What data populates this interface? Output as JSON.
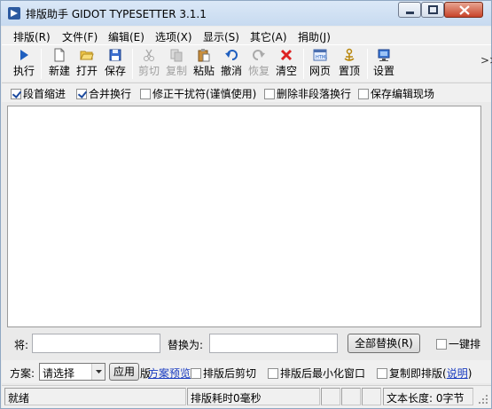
{
  "window": {
    "title": "排版助手 GIDOT TYPESETTER 3.1.1"
  },
  "menu": [
    "排版(R)",
    "文件(F)",
    "编辑(E)",
    "选项(X)",
    "显示(S)",
    "其它(A)",
    "捐助(J)"
  ],
  "toolbar": {
    "run": "执行",
    "new": "新建",
    "open": "打开",
    "save": "保存",
    "cut": "剪切",
    "copy": "复制",
    "paste": "粘贴",
    "undo": "撤消",
    "redo": "恢复",
    "clear": "清空",
    "web": "网页",
    "top": "置顶",
    "settings": "设置",
    "more": ">>"
  },
  "options": [
    {
      "label": "段首缩进",
      "checked": true
    },
    {
      "label": "合并换行",
      "checked": true
    },
    {
      "label": "修正干扰符(谨慎使用)",
      "checked": false
    },
    {
      "label": "删除非段落换行",
      "checked": false
    },
    {
      "label": "保存编辑现场",
      "checked": false
    }
  ],
  "replace": {
    "find_label": "将:",
    "find_value": "",
    "with_label": "替换为:",
    "with_value": "",
    "replace_all_button": "全部替换(R)",
    "one_click_label": "一键排"
  },
  "scheme": {
    "label": "方案:",
    "selected": "请选择",
    "apply_button": "应用",
    "preview_link": "方案预览",
    "prefix_char": "版",
    "cut_after": "排版后剪切",
    "minimize_after": "排版后最小化窗口",
    "copy_typeset": "复制即排版",
    "help_open": "(",
    "help_link": "说明",
    "help_close": ")"
  },
  "status": {
    "state": "就绪",
    "timing": "排版耗时0毫秒",
    "length": "文本长度: 0字节"
  },
  "colors": {
    "accent_blue": "#1f5fbf",
    "link": "#1a3cc0",
    "close_red": "#c8442a"
  }
}
